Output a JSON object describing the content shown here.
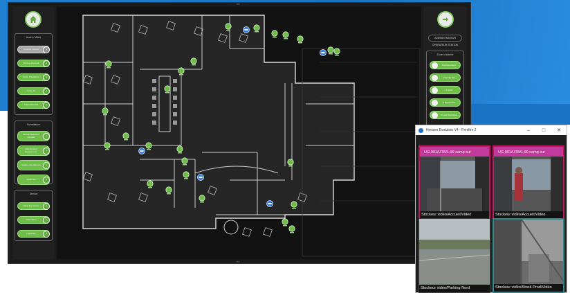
{
  "left_panel": {
    "groups": [
      {
        "title": "Accès / Vidéo",
        "buttons": [
          "Contrôle d'accès",
          "Bornes d'Accueil",
          "Accès Prestations",
          "Vidéo ID",
          "Préparation NS"
        ]
      },
      {
        "title": "Surveillance",
        "buttons": [
          "Alarme Détection incendie",
          "Maintenance Équipements",
          "Gestion des Alarmes",
          "Guide lieu"
        ]
      },
      {
        "title": "Service",
        "buttons": [
          "Salle des Ventes",
          "Information",
          "Logistique"
        ]
      }
    ]
  },
  "right_panel": {
    "header_button": "ADMINISTRATEUR",
    "header_text": "OPERATEUR STATION",
    "group_title": "Zones d'alarme",
    "buttons": [
      "Z Entrée Ouest",
      "Z Entrée Est",
      "Z Nord",
      "Z Bureau Est",
      "Z Local Technique"
    ]
  },
  "camera_window": {
    "title": "Horizon Evolution V4 - Fenêtre 2",
    "cameras": [
      {
        "osd": "UG 001/UTB/1.99 camp sur",
        "caption": "Stockeur vidéo/Accueil/Vidéo"
      },
      {
        "osd": "UG 001/UTB/1.99 camp sur",
        "caption": "Stockeur vidéo/Accueil/Vidéo"
      },
      {
        "osd": "",
        "caption": "Stockeur vidéo/Parking Nord"
      },
      {
        "osd": "",
        "caption": "Stockeur vidéo/Stock Prod/Vidéo"
      }
    ]
  },
  "colors": {
    "accent": "#6fbe4a",
    "brand_blue": "#1a73c4",
    "cam_alarm": "#c2185b",
    "cam_select": "#2a8a8a"
  }
}
